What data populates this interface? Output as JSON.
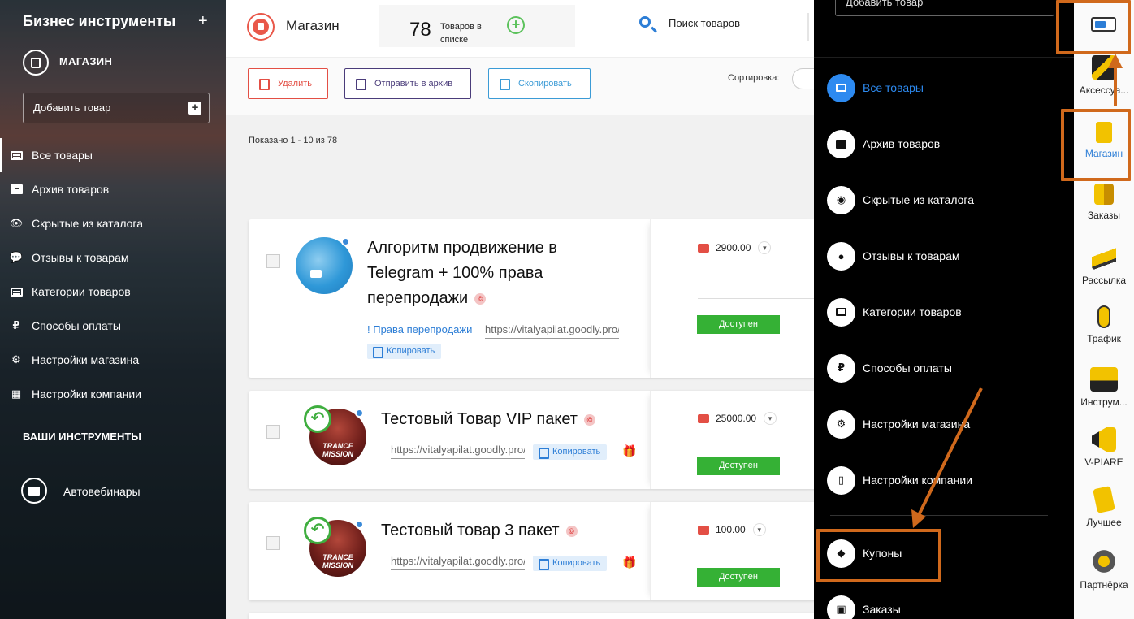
{
  "sidebar": {
    "title": "Бизнес инструменты",
    "plus": "+",
    "shop_label": "МАГАЗИН",
    "add_product": "Добавить товар",
    "items": [
      {
        "label": "Все товары",
        "icon": "list-icon"
      },
      {
        "label": "Архив товаров",
        "icon": "archive-icon"
      },
      {
        "label": "Скрытые из каталога",
        "icon": "eye-hidden-icon"
      },
      {
        "label": "Отзывы к товарам",
        "icon": "chat-icon"
      },
      {
        "label": "Категории товаров",
        "icon": "category-icon"
      },
      {
        "label": "Способы оплаты",
        "icon": "ruble-icon"
      },
      {
        "label": "Настройки магазина",
        "icon": "gear-icon"
      },
      {
        "label": "Настройки компании",
        "icon": "building-icon"
      }
    ],
    "section_title": "ВАШИ ИНСТРУМЕНТЫ",
    "webinars": "Автовебинары"
  },
  "topbar": {
    "shop_title": "Магазин",
    "count": "78",
    "count_label": "Товаров в списке",
    "search_label": "Поиск товаров"
  },
  "actions": {
    "delete": "Удалить",
    "archive": "Отправить в архив",
    "copy": "Скопировать",
    "sort_label": "Сортировка:"
  },
  "shown": "Показано 1 - 10 из 78",
  "products": [
    {
      "title": "Алгоритм продвижение в Telegram + 100% права перепродажи",
      "link": "! Права перепродажи",
      "url": "https://vitalyapilat.goodly.pro/...",
      "copy": "Копировать",
      "price": "2900.00",
      "status": "Доступен"
    },
    {
      "title": "Тестовый Товар VIP пакет",
      "url": "https://vitalyapilat.goodly.pro/...",
      "copy": "Копировать",
      "price": "25000.00",
      "status": "Доступен",
      "avatar_text": "TRANCE MISSION"
    },
    {
      "title": "Тестовый товар 3 пакет",
      "url": "https://vitalyapilat.goodly.pro/...",
      "copy": "Копировать",
      "price": "100.00",
      "status": "Доступен",
      "avatar_text": "TRANCE MISSION"
    }
  ],
  "overlay": {
    "add_product": "Добавить товар",
    "items": [
      {
        "label": "Все товары",
        "active": true
      },
      {
        "label": "Архив товаров"
      },
      {
        "label": "Скрытые из каталога"
      },
      {
        "label": "Отзывы к товарам"
      },
      {
        "label": "Категории товаров"
      },
      {
        "label": "Способы оплаты"
      },
      {
        "label": "Настройки магазина"
      },
      {
        "label": "Настройки компании"
      },
      {
        "label": "Купоны"
      },
      {
        "label": "Заказы"
      }
    ]
  },
  "dock": {
    "items": [
      {
        "label": "Аксессуа...",
        "icon": "accessories-icon"
      },
      {
        "label": "Магазин",
        "icon": "shop-bag-icon",
        "active": true
      },
      {
        "label": "Заказы",
        "icon": "orders-icon"
      },
      {
        "label": "Рассылка",
        "icon": "mailing-icon"
      },
      {
        "label": "Трафик",
        "icon": "mouse-icon"
      },
      {
        "label": "Инструм...",
        "icon": "toolbox-icon"
      },
      {
        "label": "V-PIARE",
        "icon": "megaphone-icon"
      },
      {
        "label": "Лучшее",
        "icon": "best-icon"
      },
      {
        "label": "Партнёрка",
        "icon": "partner-gear-icon"
      }
    ]
  },
  "colors": {
    "accent_blue": "#2d8af0",
    "annotation_orange": "#d0691c",
    "status_green": "#35b135",
    "danger_red": "#e34f45"
  }
}
